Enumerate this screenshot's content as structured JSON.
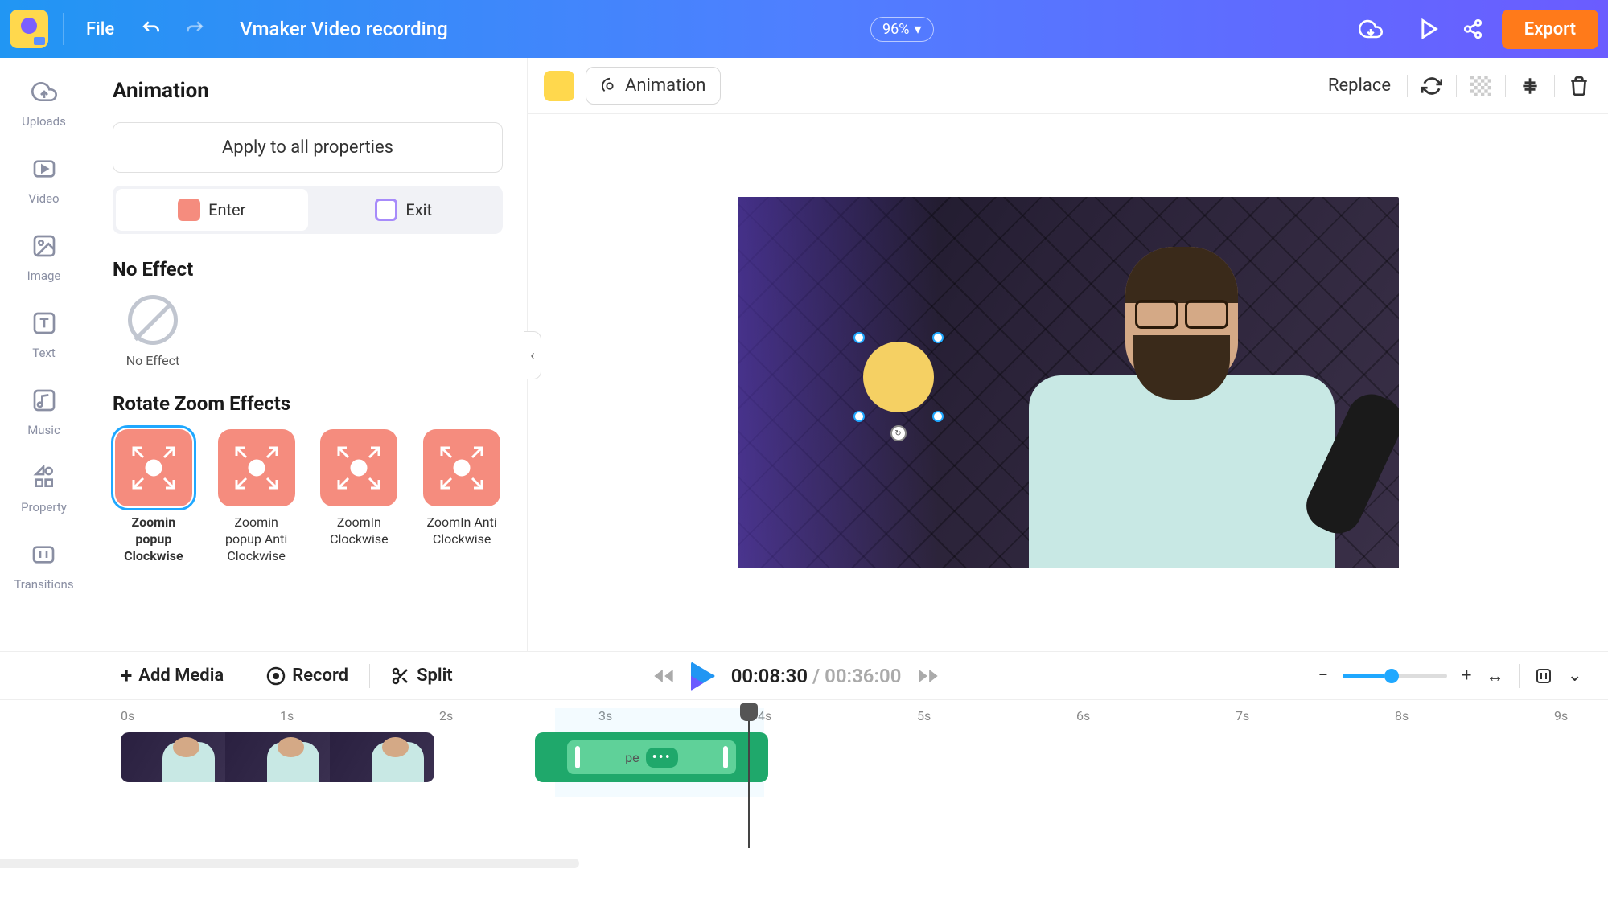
{
  "header": {
    "file_label": "File",
    "project_title": "Vmaker Video recording",
    "zoom": "96%",
    "export_label": "Export"
  },
  "side_nav": [
    {
      "label": "Uploads",
      "name": "nav-uploads"
    },
    {
      "label": "Video",
      "name": "nav-video"
    },
    {
      "label": "Image",
      "name": "nav-image"
    },
    {
      "label": "Text",
      "name": "nav-text"
    },
    {
      "label": "Music",
      "name": "nav-music"
    },
    {
      "label": "Property",
      "name": "nav-property"
    },
    {
      "label": "Transitions",
      "name": "nav-transitions"
    }
  ],
  "panel": {
    "title": "Animation",
    "apply_all": "Apply to all properties",
    "enter_label": "Enter",
    "exit_label": "Exit",
    "no_effect_title": "No Effect",
    "no_effect_label": "No Effect",
    "rotate_title": "Rotate Zoom Effects",
    "effects": [
      {
        "label": "Zoomin popup Clockwise",
        "selected": true
      },
      {
        "label": "Zoomin popup Anti Clockwise",
        "selected": false
      },
      {
        "label": "ZoomIn Clockwise",
        "selected": false
      },
      {
        "label": "ZoomIn Anti Clockwise",
        "selected": false
      }
    ]
  },
  "canvas_toolbar": {
    "animation_label": "Animation",
    "replace_label": "Replace"
  },
  "timeline_bar": {
    "add_media": "Add Media",
    "record": "Record",
    "split": "Split",
    "time_current": "00:08:30",
    "time_total": "00:36:00"
  },
  "ruler": [
    "0s",
    "1s",
    "2s",
    "3s",
    "4s",
    "5s",
    "6s",
    "7s",
    "8s",
    "9s"
  ]
}
